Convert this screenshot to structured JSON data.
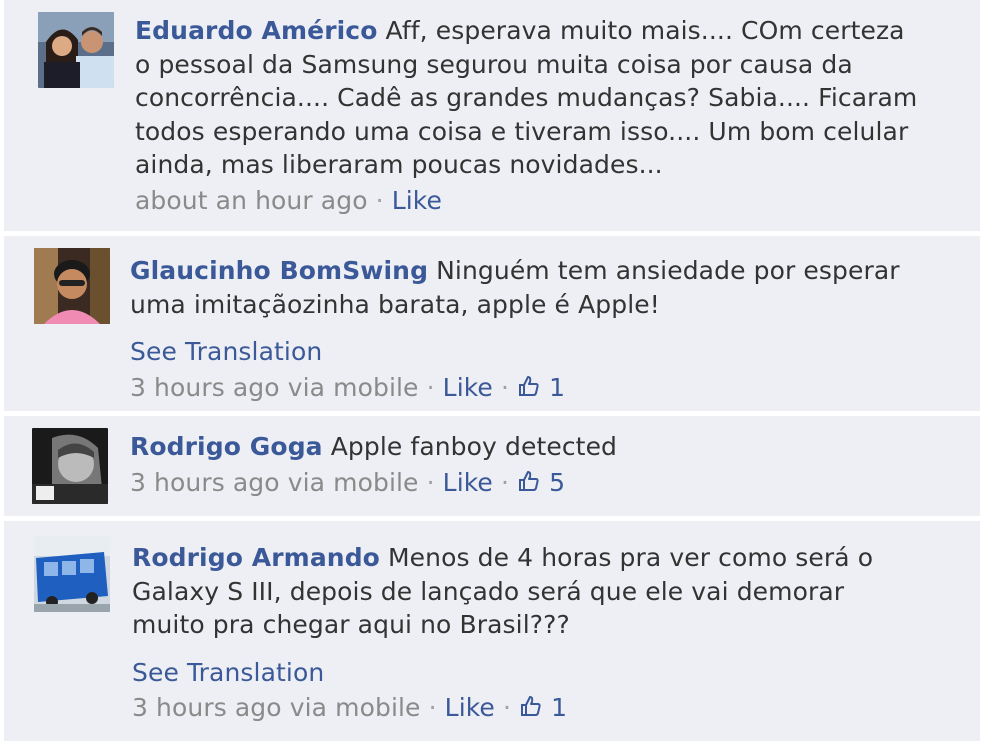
{
  "comments": [
    {
      "author": "Eduardo Américo",
      "text": "Aff, esperava muito mais.... COm certeza o pessoal da Samsung segurou muita coisa por causa da concorrência.... Cadê as grandes mudanças? Sabia.... Ficaram todos esperando uma coisa e tiveram isso.... Um bom celular ainda, mas liberaram poucas novidades...",
      "time": "about an hour ago",
      "sep": "·",
      "like": "Like"
    },
    {
      "author": "Glaucinho BomSwing",
      "text": "Ninguém tem ansiedade por esperar uma imitaçãozinha barata, apple é Apple!",
      "translation": "See Translation",
      "time": "3 hours ago via mobile",
      "sep": "·",
      "like": "Like",
      "likes": "1"
    },
    {
      "author": "Rodrigo Goga",
      "text": "Apple fanboy detected",
      "time": "3 hours ago via mobile",
      "sep": "·",
      "like": "Like",
      "likes": "5"
    },
    {
      "author": "Rodrigo Armando",
      "text": "Menos de 4 horas pra ver como será o Galaxy S III, depois de lançado será que ele vai demorar muito pra chegar aqui no Brasil???",
      "translation": "See Translation",
      "time": "3 hours ago via mobile",
      "sep": "·",
      "like": "Like",
      "likes": "1"
    }
  ],
  "colors": {
    "link": "#3b5998",
    "text": "#333333",
    "meta": "#8a8a8a",
    "background": "#edeff4"
  },
  "icons": {
    "avatar": "user-photo",
    "like_count": "thumbs-up-icon"
  }
}
